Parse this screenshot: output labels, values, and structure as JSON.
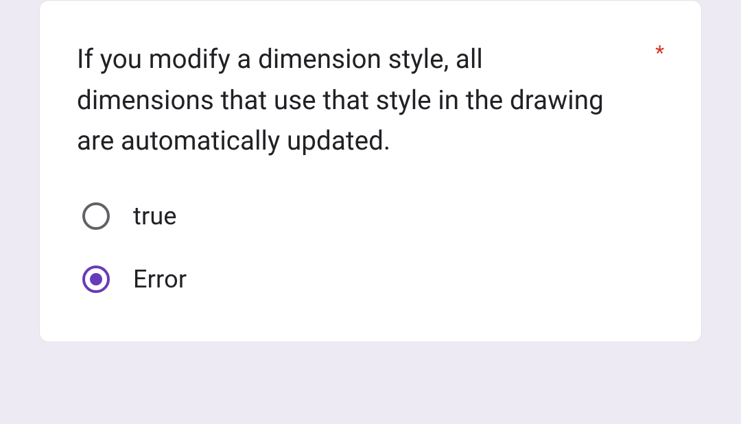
{
  "question": {
    "text": "If you modify a dimension style, all dimensions that use that style in the drawing are automatically updated.",
    "required_marker": "*"
  },
  "options": [
    {
      "label": "true",
      "selected": false
    },
    {
      "label": "Error",
      "selected": true
    }
  ]
}
